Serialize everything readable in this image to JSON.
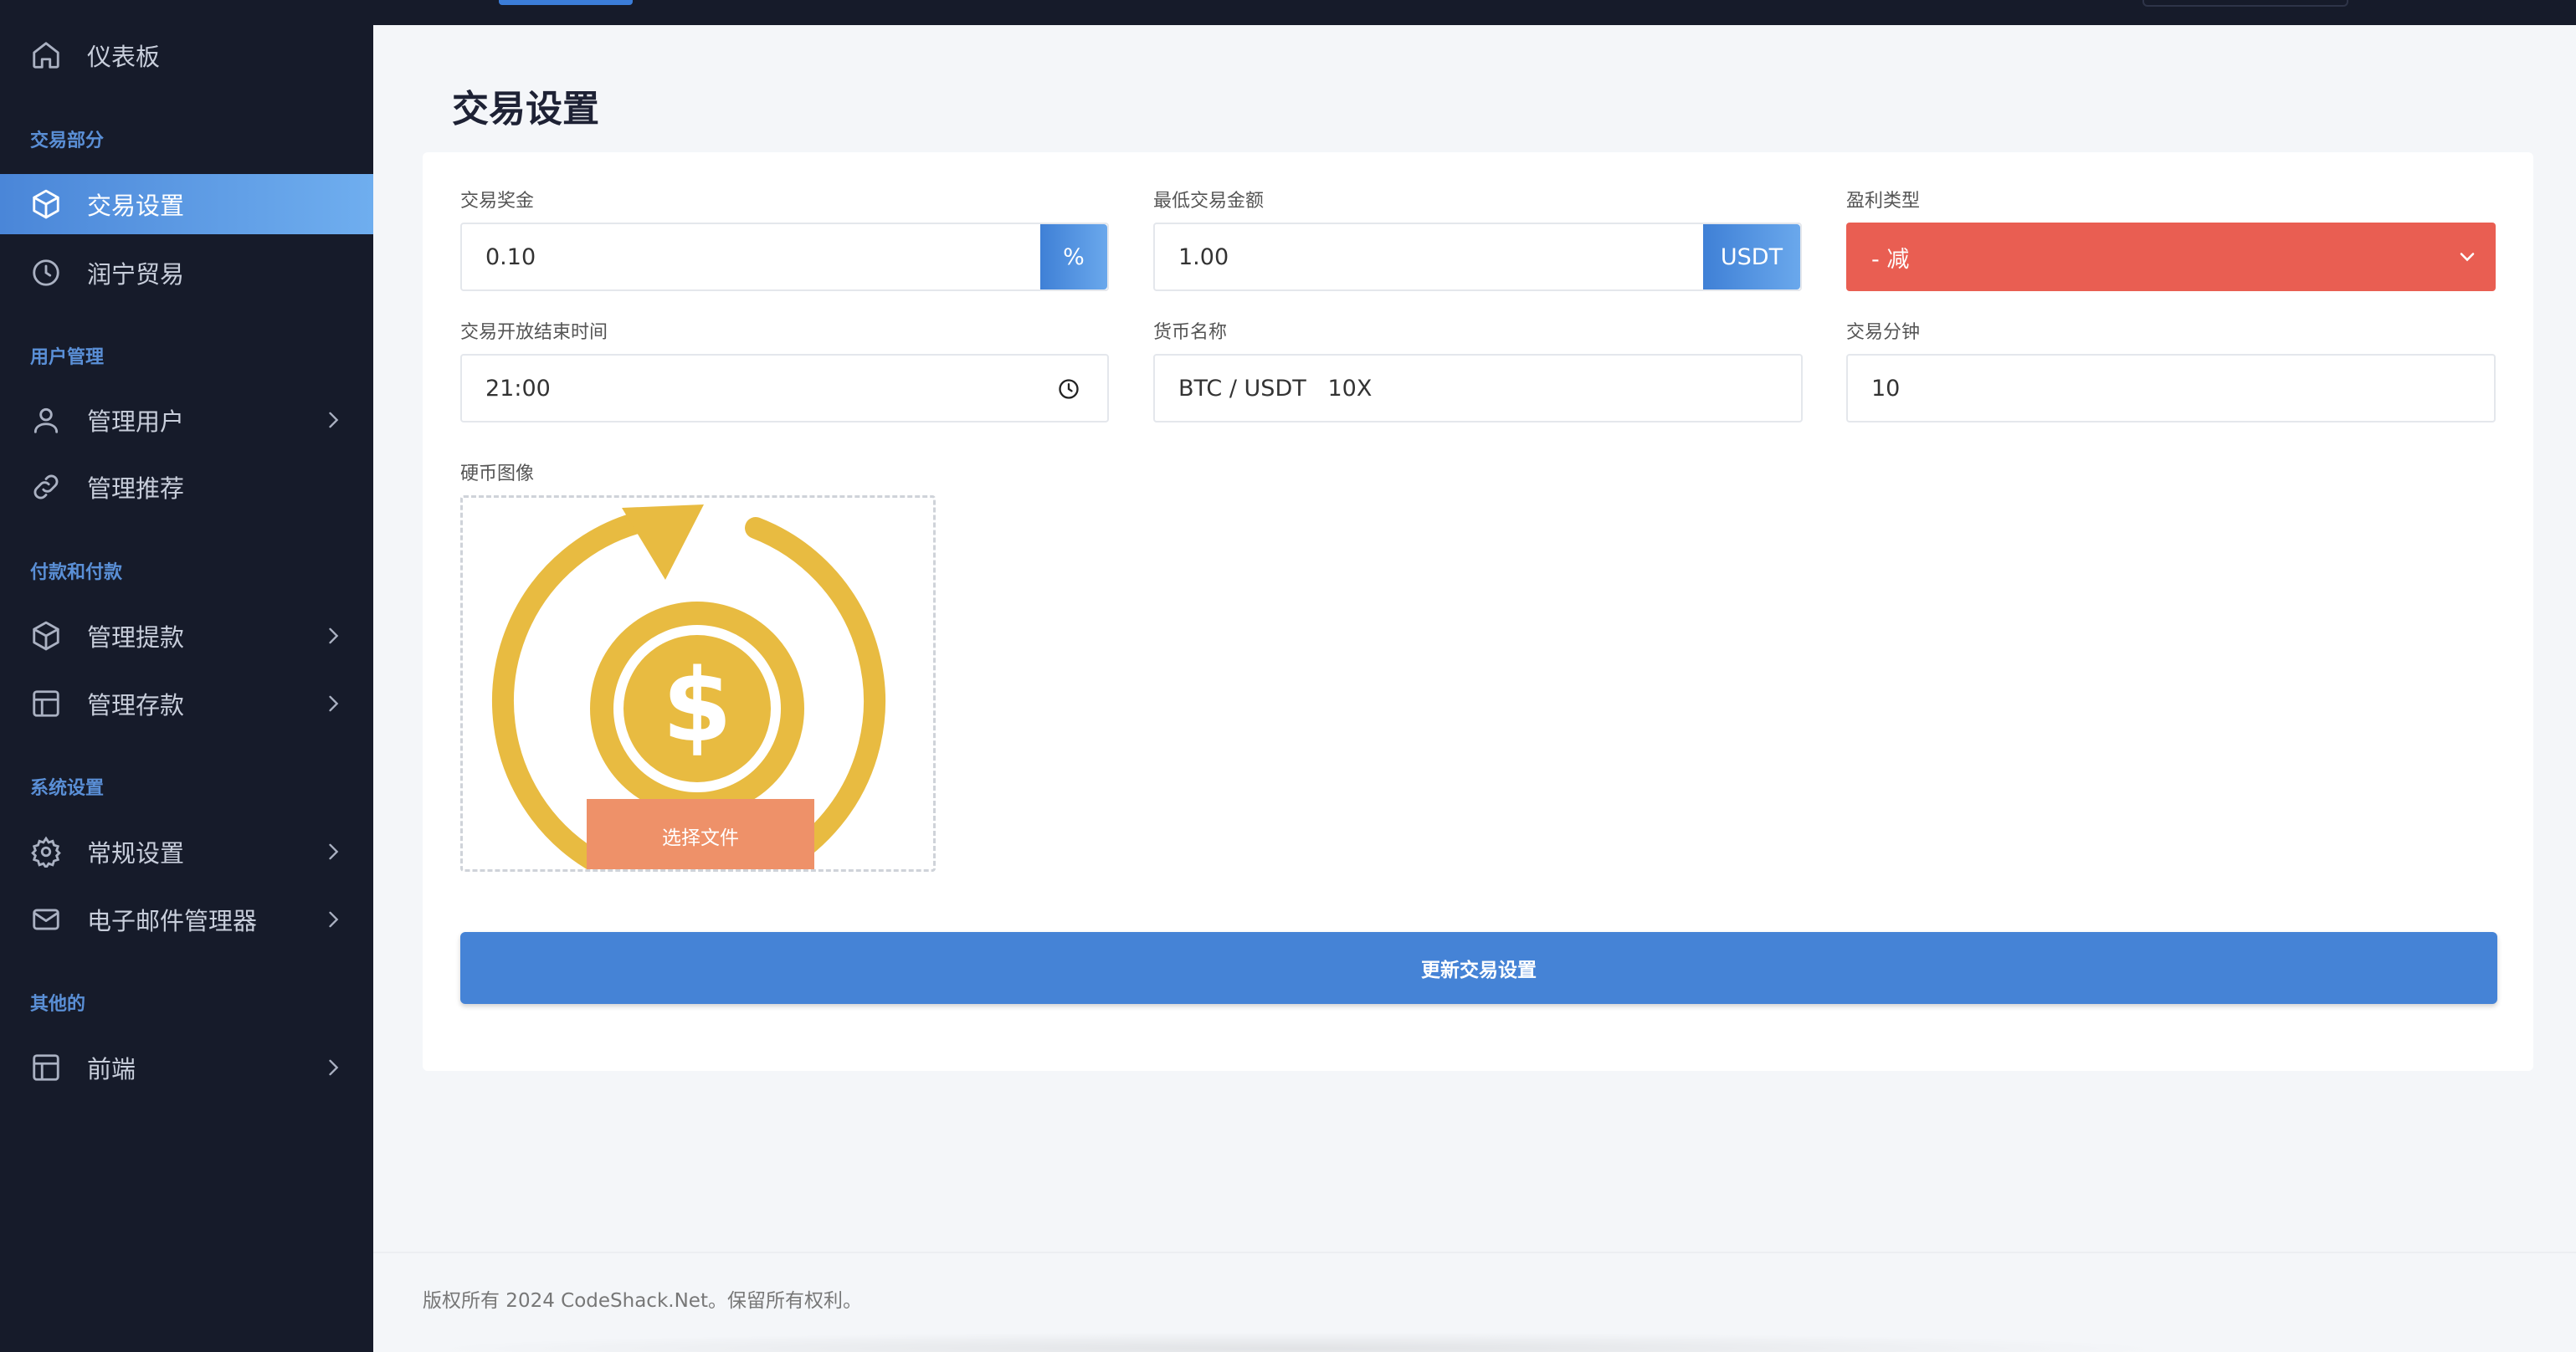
{
  "sidebar": {
    "dashboard": "仪表板",
    "sections": {
      "trading": "交易部分",
      "users": "用户管理",
      "payments": "付款和付款",
      "system": "系统设置",
      "other": "其他的"
    },
    "items": {
      "trade_settings": "交易设置",
      "runing_trade": "润宁贸易",
      "manage_users": "管理用户",
      "manage_referrals": "管理推荐",
      "manage_withdrawals": "管理提款",
      "manage_deposits": "管理存款",
      "general_settings": "常规设置",
      "email_manager": "电子邮件管理器",
      "frontend": "前端"
    }
  },
  "page": {
    "title": "交易设置"
  },
  "form": {
    "trade_bonus": {
      "label": "交易奖金",
      "value": "0.10",
      "addon": "%"
    },
    "min_trade_amount": {
      "label": "最低交易金额",
      "value": "1.00",
      "addon": "USDT"
    },
    "profit_type": {
      "label": "盈利类型",
      "value": "- 减"
    },
    "open_close_time": {
      "label": "交易开放结束时间",
      "value": "21:00"
    },
    "currency_name": {
      "label": "货币名称",
      "value": "BTC / USDT   10X"
    },
    "trade_minutes": {
      "label": "交易分钟",
      "value": "10"
    },
    "coin_image": {
      "label": "硬币图像",
      "file_button": "选择文件"
    },
    "submit": "更新交易设置"
  },
  "footer": {
    "copyright": "版权所有 2024 CodeShack.Net。保留所有权利。"
  },
  "colors": {
    "sidebar_bg": "#161b2a",
    "accent": "#4583d6",
    "danger": "#e95e52",
    "file_button": "#ee9169",
    "coin_gold": "#e8bb41"
  },
  "icons": {
    "dashboard": "home-icon",
    "trade_settings": "box-icon",
    "runing_trade": "clock-icon",
    "manage_users": "user-icon",
    "manage_referrals": "link-icon",
    "manage_withdrawals": "box-icon",
    "manage_deposits": "layout-icon",
    "general_settings": "gear-icon",
    "email_manager": "mail-icon",
    "frontend": "layout-icon"
  }
}
